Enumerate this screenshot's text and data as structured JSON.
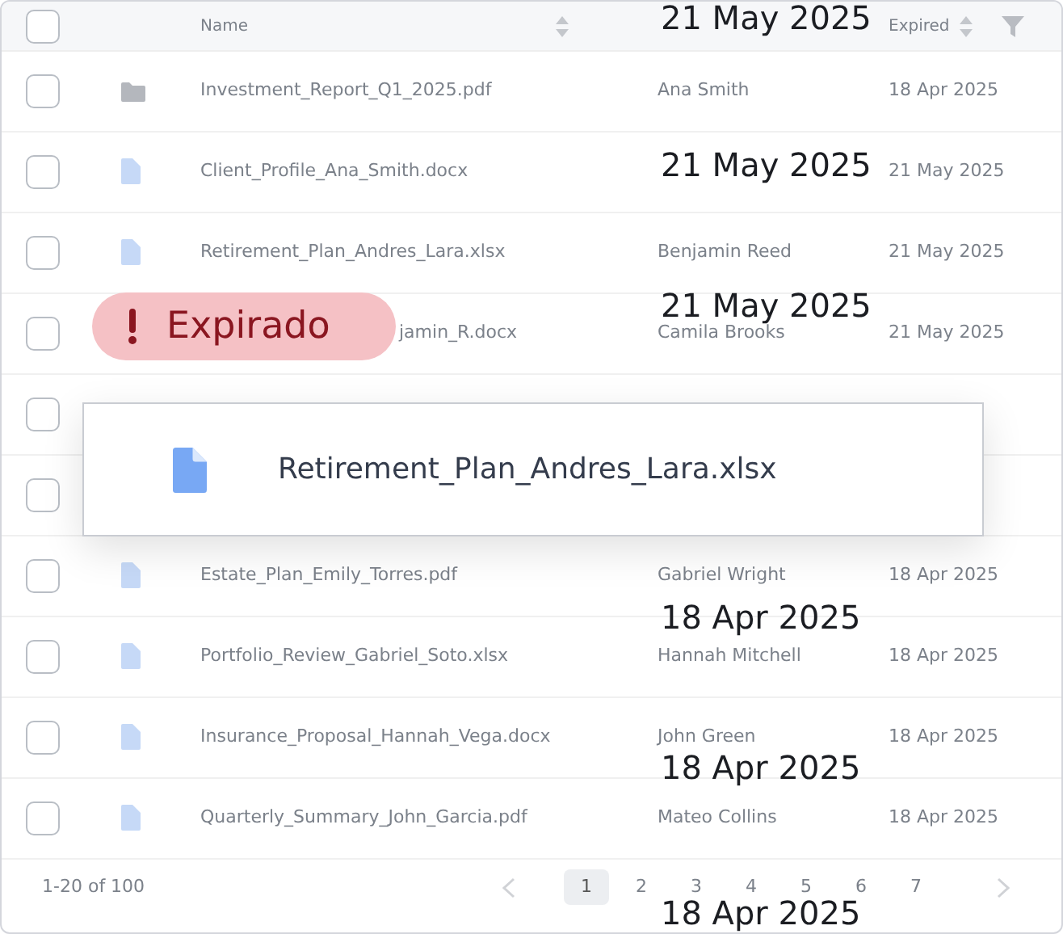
{
  "table": {
    "header": {
      "checked": false,
      "name_column": {
        "label": "Name"
      },
      "expired_column": {
        "label": "Expired"
      }
    },
    "rows": [
      {
        "checked": false,
        "kind": "folder",
        "name": "Investment_Report_Q1_2025.pdf",
        "owner": "Ana Smith",
        "expired": "18 Apr 2025"
      },
      {
        "checked": false,
        "kind": "file",
        "name": "Client_Profile_Ana_Smith.docx",
        "expired": "21 May 2025"
      },
      {
        "checked": false,
        "kind": "file",
        "name": "Retirement_Plan_Andres_Lara.xlsx",
        "owner": "Benjamin Reed",
        "expired": "21 May 2025"
      },
      {
        "checked": false,
        "name": "jamin_R.docx",
        "covered_start": true,
        "owner": "Camila Brooks",
        "expired": "21 May 2025"
      },
      {
        "checked": false
      },
      {
        "checked": false
      },
      {
        "checked": false,
        "kind": "file",
        "name": "Estate_Plan_Emily_Torres.pdf",
        "owner": "Gabriel Wright",
        "expired": "18 Apr 2025"
      },
      {
        "checked": false,
        "kind": "file",
        "name": "Portfolio_Review_Gabriel_Soto.xlsx",
        "owner": "Hannah Mitchell",
        "expired": "18 Apr 2025"
      },
      {
        "checked": false,
        "kind": "file",
        "name": "Insurance_Proposal_Hannah_Vega.docx",
        "owner": "John Green",
        "expired": "18 Apr 2025"
      },
      {
        "checked": false,
        "kind": "file",
        "name": "Quarterly_Summary_John_Garcia.pdf",
        "owner": "Mateo Collins",
        "expired": "18 Apr 2025"
      }
    ]
  },
  "pagination": {
    "range": "1-20 of 100",
    "pages": [
      {
        "label": "1",
        "selected": true
      },
      {
        "label": "2",
        "selected": false
      },
      {
        "label": "3",
        "selected": false
      },
      {
        "label": "4",
        "selected": false
      },
      {
        "label": "5",
        "selected": false
      },
      {
        "label": "6",
        "selected": false
      },
      {
        "label": "7",
        "selected": false
      }
    ]
  },
  "status_badge": {
    "label": "Expirado"
  },
  "drag_preview": {
    "name": "Retirement_Plan_Andres_Lara.xlsx"
  },
  "date_labels": [
    {
      "text": "21 May 2025"
    },
    {
      "text": "21 May 2025"
    },
    {
      "text": "21 May 2025"
    },
    {
      "text": "18 Apr 2025"
    },
    {
      "text": "18 Apr 2025"
    },
    {
      "text": "18 Apr 2025"
    }
  ]
}
